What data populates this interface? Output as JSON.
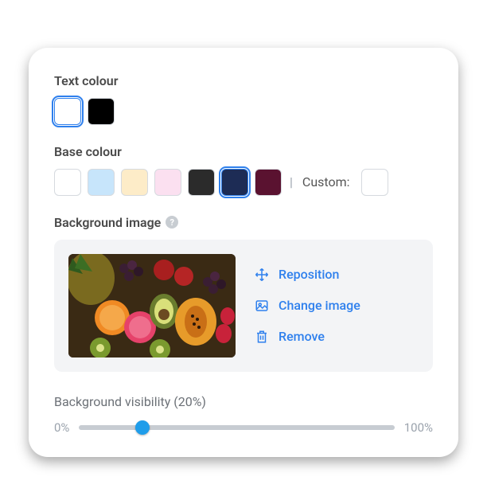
{
  "textColour": {
    "label": "Text colour",
    "swatches": [
      {
        "color": "#ffffff",
        "selected": true
      },
      {
        "color": "#000000",
        "selected": false
      }
    ]
  },
  "baseColour": {
    "label": "Base colour",
    "swatches": [
      {
        "color": "#ffffff",
        "selected": false
      },
      {
        "color": "#c7e5fb",
        "selected": false
      },
      {
        "color": "#fdecc8",
        "selected": false
      },
      {
        "color": "#fbe0f0",
        "selected": false
      },
      {
        "color": "#2b2b2b",
        "selected": false
      },
      {
        "color": "#1d2c55",
        "selected": true
      },
      {
        "color": "#5a1230",
        "selected": false
      }
    ],
    "customLabel": "Custom:",
    "customSwatch": "#ffffff"
  },
  "backgroundImage": {
    "label": "Background image",
    "actions": {
      "reposition": "Reposition",
      "change": "Change image",
      "remove": "Remove"
    }
  },
  "visibility": {
    "label": "Background visibility (20%)",
    "min": "0%",
    "max": "100%",
    "value": 20
  }
}
